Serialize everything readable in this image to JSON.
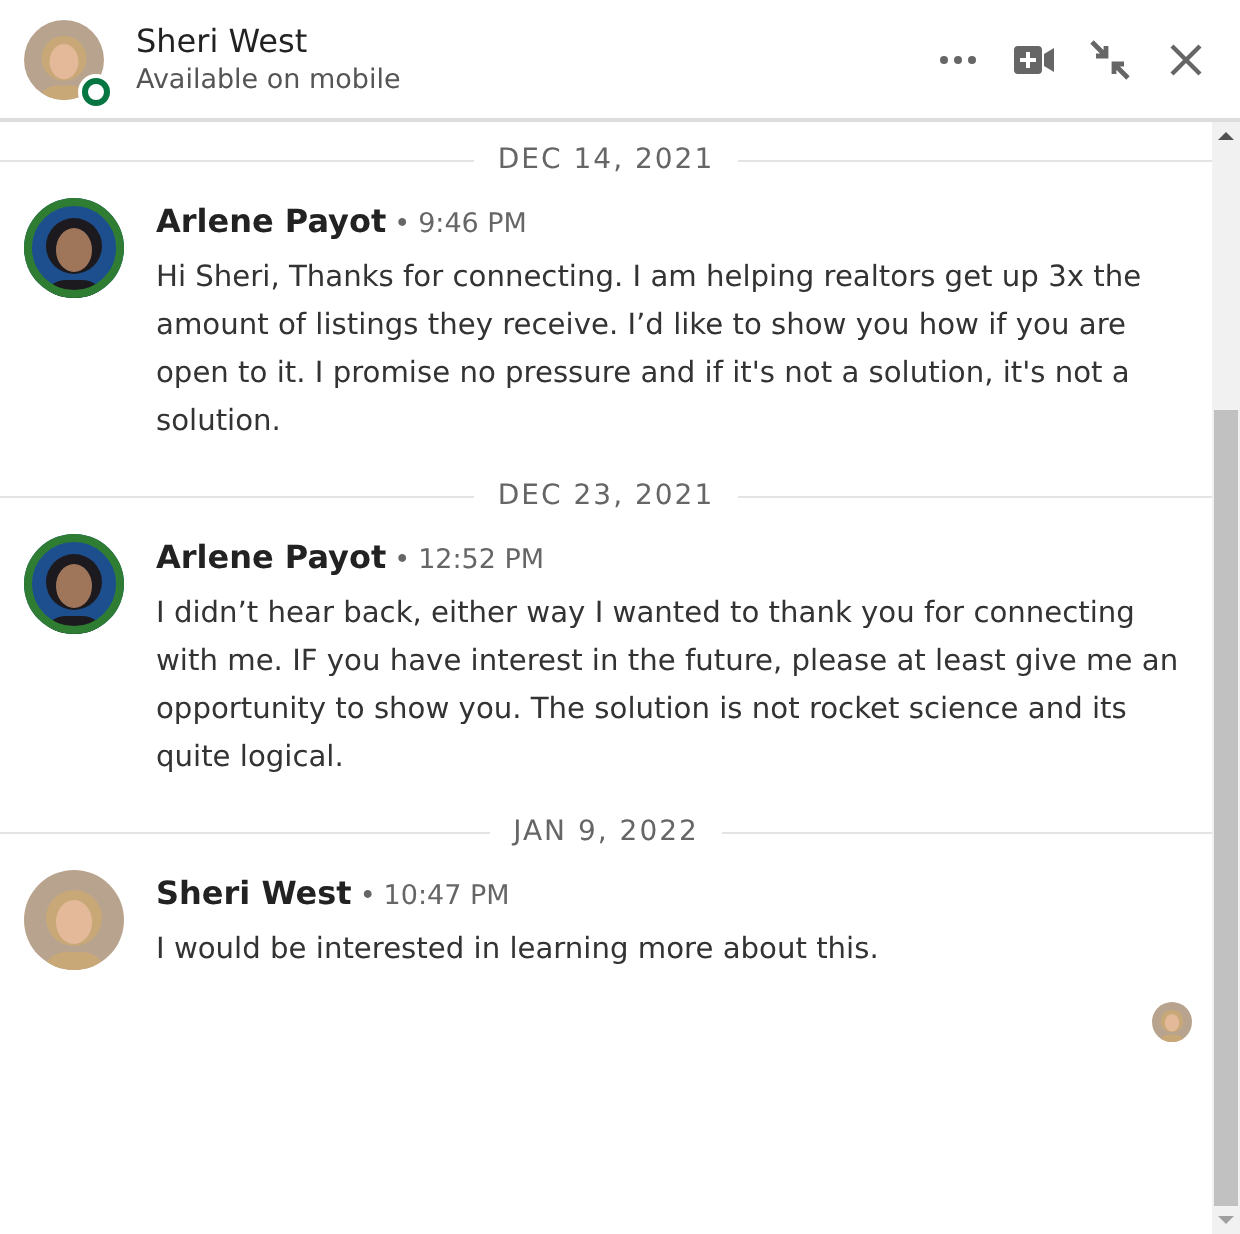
{
  "header": {
    "name": "Sheri West",
    "status": "Available on mobile",
    "online": true
  },
  "conversation": [
    {
      "date": "DEC 14, 2021",
      "messages": [
        {
          "sender": "Arlene Payot",
          "separator": "•",
          "time": "9:46 PM",
          "text": "Hi Sheri, Thanks for connecting. I am helping realtors get up 3x the amount of listings they receive. I’d like to show you how if you are open to it. I promise no pressure and if it's not a solution, it's not a solution."
        }
      ]
    },
    {
      "date": "DEC 23, 2021",
      "messages": [
        {
          "sender": "Arlene Payot",
          "separator": "•",
          "time": "12:52 PM",
          "text": "I didn’t hear back, either way I wanted to thank you for connecting with me. IF you have interest in the future, please at least give me an opportunity to show you. The solution is not rocket science and its quite logical."
        }
      ]
    },
    {
      "date": "JAN 9, 2022",
      "messages": [
        {
          "sender": "Sheri West",
          "separator": "•",
          "time": "10:47 PM",
          "text": "I would be interested in learning more about this."
        }
      ]
    }
  ],
  "seen": true
}
